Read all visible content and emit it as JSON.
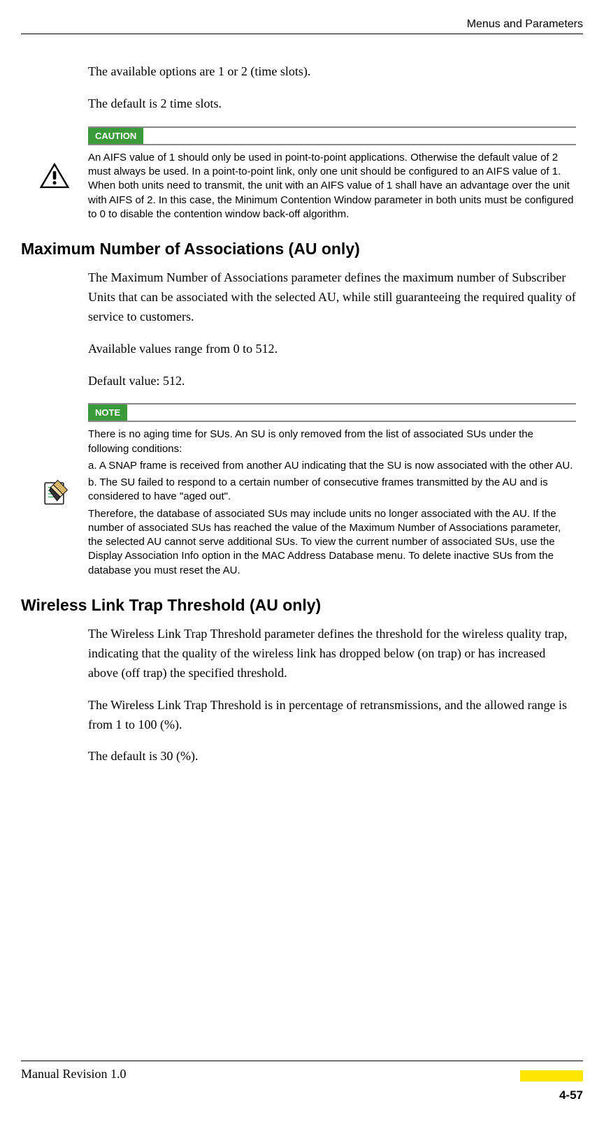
{
  "header": {
    "title": "Menus and Parameters"
  },
  "intro": {
    "p1": "The available options are 1 or 2 (time slots).",
    "p2": "The default is 2 time slots."
  },
  "caution": {
    "label": "CAUTION",
    "text": "An AIFS value of 1 should only be used in point-to-point applications. Otherwise the default value of 2 must always be used. In a point-to-point link, only one unit should be configured to an AIFS value of 1. When both units need to transmit, the unit with an AIFS value of 1 shall have an advantage over the unit with AIFS of 2. In this case, the Minimum Contention Window parameter in both units must be configured to 0 to disable the contention window back-off algorithm."
  },
  "section1": {
    "heading": "Maximum Number of Associations (AU only)",
    "p1": "The Maximum Number of Associations parameter defines the maximum number of Subscriber Units that can be associated with the selected AU, while still guaranteeing the required quality of service to customers.",
    "p2": "Available values range from 0 to 512.",
    "p3": "Default value: 512."
  },
  "note": {
    "label": "NOTE",
    "p1": "There is no aging time for SUs. An SU is only removed from the list of associated SUs under the following conditions:",
    "p2": "a.  A SNAP frame is received from another AU indicating that the SU is now associated with the other AU.",
    "p3": "b.  The SU failed to respond to a certain number of consecutive frames transmitted by the AU and is considered to have \"aged out\".",
    "p4": "Therefore, the database of associated SUs may include units no longer associated with the AU. If the number of associated SUs has reached the value of the Maximum Number of Associations parameter, the selected AU cannot serve additional SUs. To view the current number of associated SUs, use the Display Association Info option in the MAC Address Database menu. To delete inactive SUs from the database you must reset the AU."
  },
  "section2": {
    "heading": "Wireless Link Trap Threshold (AU only)",
    "p1": "The Wireless Link Trap Threshold parameter defines the threshold for the wireless quality trap, indicating that the quality of the wireless link has dropped below (on trap) or has increased above (off trap) the specified threshold.",
    "p2": "The Wireless Link Trap Threshold is in percentage of retransmissions, and the allowed range is from 1 to 100 (%).",
    "p3": "The default is 30 (%)."
  },
  "footer": {
    "revision": "Manual Revision 1.0",
    "page": "4-57"
  }
}
